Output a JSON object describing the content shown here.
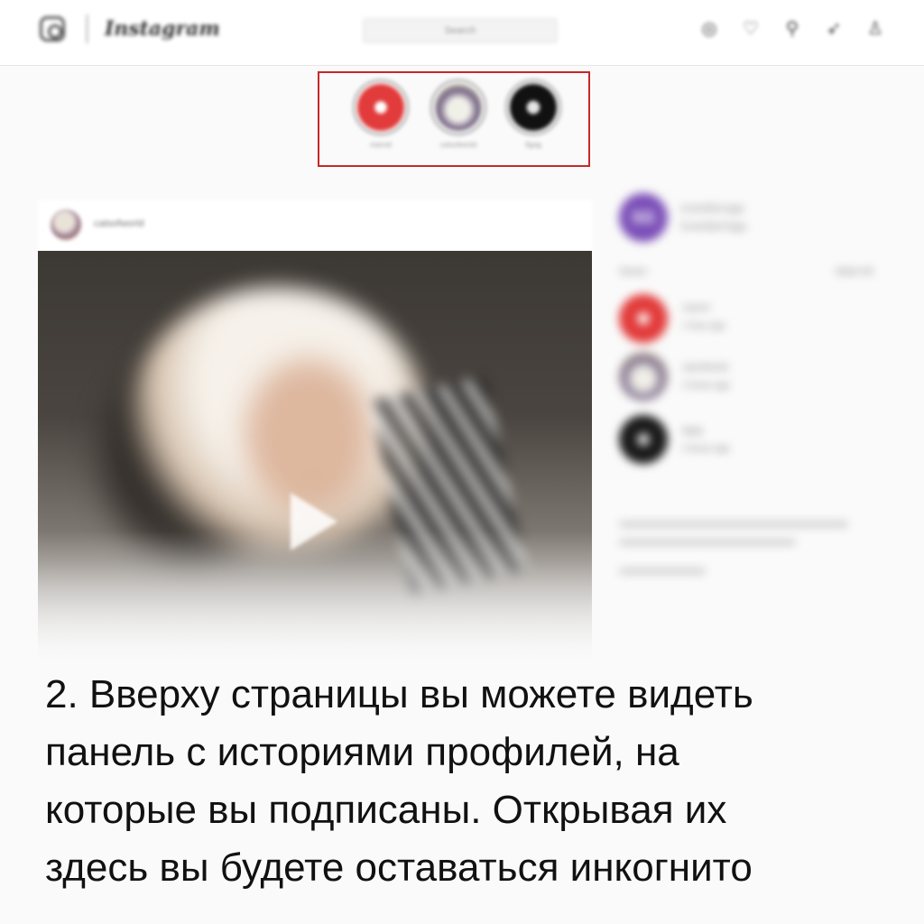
{
  "header": {
    "logo_text": "Instagram",
    "search_placeholder": "Search",
    "icons": [
      "compass-icon",
      "heart-icon",
      "person-icon",
      "send-icon",
      "profile-icon"
    ]
  },
  "stories": [
    {
      "name": "marvel",
      "color": "#e23b3b"
    },
    {
      "name": "catsofworld",
      "color": "#cfcfb0"
    },
    {
      "name": "9gag",
      "color": "#111111"
    }
  ],
  "post": {
    "username": "catsofworld"
  },
  "sidebar": {
    "avatar_initials": "SG",
    "username": "scrambled.eggs",
    "subtitle": "Scrambled Eggs",
    "section_label": "Stories",
    "see_all": "Watch All",
    "story_users": [
      {
        "name": "marvel",
        "meta": "1 hour ago"
      },
      {
        "name": "catsofworld",
        "meta": "2 hours ago"
      },
      {
        "name": "9gag",
        "meta": "3 hours ago"
      }
    ]
  },
  "caption": {
    "lines": [
      "2. Вверху страницы вы можете видеть",
      "панель с историями профилей, на",
      "которые вы подписаны. Открывая их",
      "здесь вы будете оставаться инкогнито"
    ]
  },
  "colors": {
    "highlight_border": "#c62828",
    "brand_purple": "#7b4fb8",
    "marvel_red": "#e23b3b"
  }
}
